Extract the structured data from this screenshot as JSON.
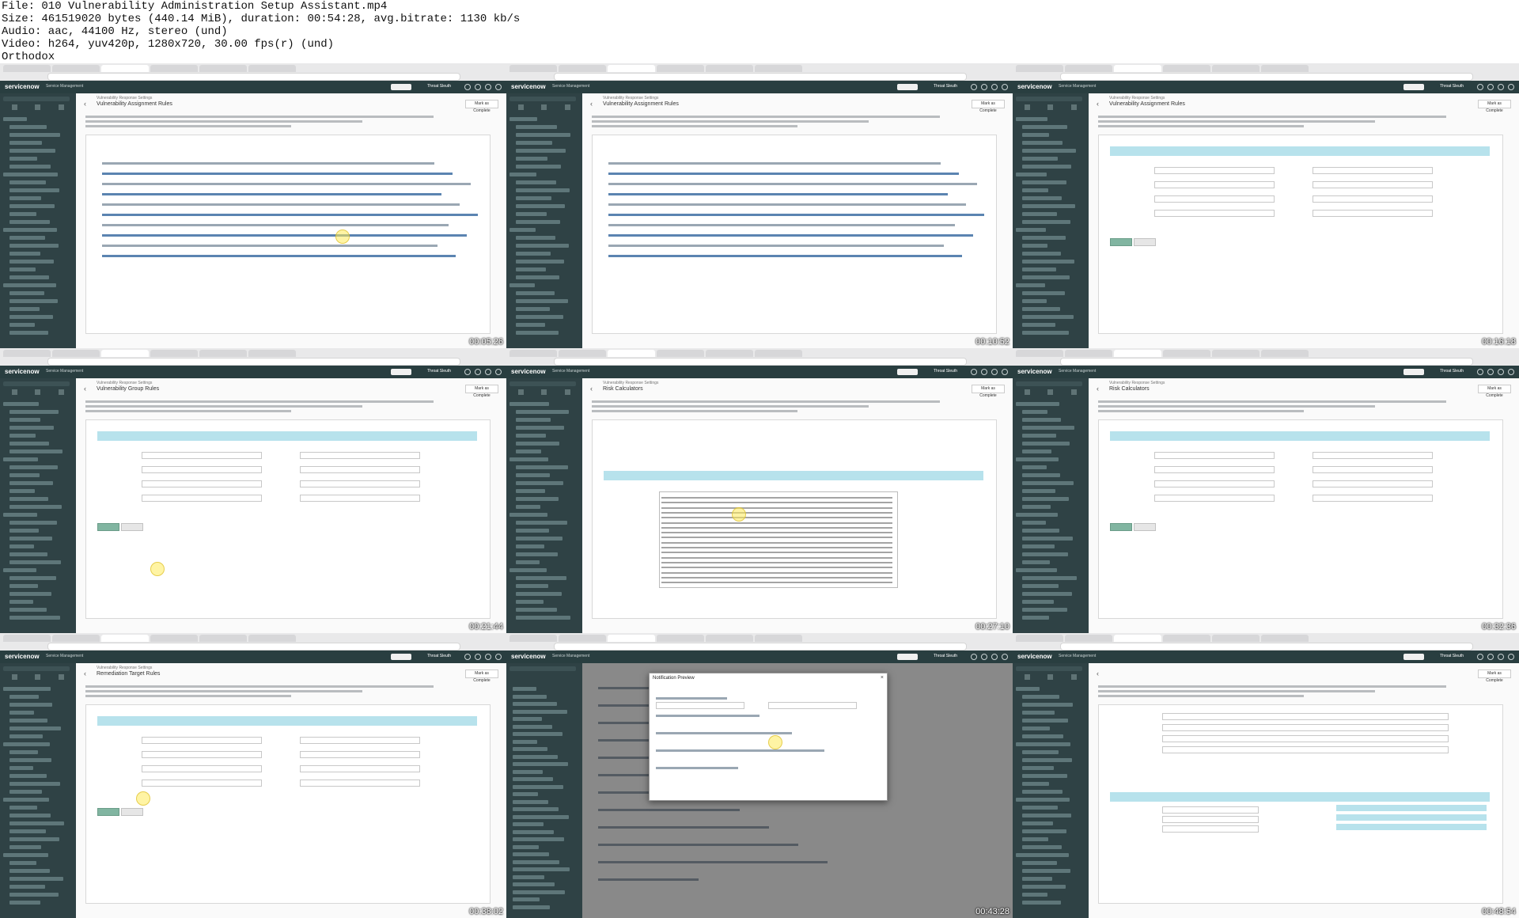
{
  "header": {
    "lines": [
      "File: 010 Vulnerability Administration Setup Assistant.mp4",
      "Size: 461519020 bytes (440.14 MiB), duration: 00:54:28, avg.bitrate: 1130 kb/s",
      "Audio: aac, 44100 Hz, stereo (und)",
      "Video: h264, yuv420p, 1280x720, 30.00 fps(r) (und)",
      "Orthodox"
    ]
  },
  "tiles": [
    {
      "title": "Vulnerability Assignment Rules",
      "subtitle": "Vulnerability Response Settings",
      "timestamp": "00:05:26",
      "kind": "list"
    },
    {
      "title": "Vulnerability Assignment Rules",
      "subtitle": "Vulnerability Response Settings",
      "timestamp": "00:10:52",
      "kind": "list"
    },
    {
      "title": "Vulnerability Assignment Rules",
      "subtitle": "Vulnerability Response Settings",
      "timestamp": "00:16:18",
      "kind": "form"
    },
    {
      "title": "Vulnerability Group Rules",
      "subtitle": "Vulnerability Response Settings",
      "timestamp": "00:21:44",
      "kind": "form"
    },
    {
      "title": "Risk Calculators",
      "subtitle": "Vulnerability Response Settings",
      "timestamp": "00:27:10",
      "kind": "table"
    },
    {
      "title": "Risk Calculators",
      "subtitle": "Vulnerability Response Settings",
      "timestamp": "00:32:36",
      "kind": "form"
    },
    {
      "title": "Remediation Target Rules",
      "subtitle": "Vulnerability Response Settings",
      "timestamp": "00:38:02",
      "kind": "form"
    },
    {
      "title": "Notification Preview",
      "subtitle": "",
      "timestamp": "00:43:28",
      "kind": "modal"
    },
    {
      "title": "",
      "subtitle": "",
      "timestamp": "00:48:54",
      "kind": "rollup"
    }
  ],
  "ui": {
    "logo": "servicenow",
    "product": "Service Management",
    "user": "Throat Sleuth",
    "mark_complete": "Mark as Complete"
  }
}
